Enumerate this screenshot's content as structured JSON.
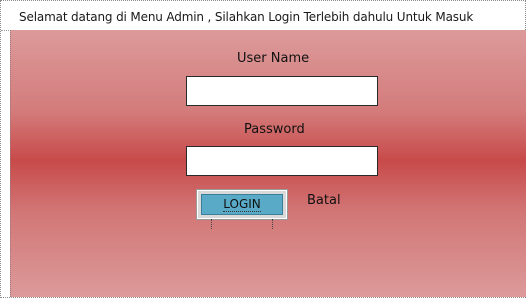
{
  "header": {
    "text": "Selamat datang di Menu Admin , Silahkan Login Terlebih dahulu Untuk Masuk"
  },
  "form": {
    "username_label": "User Name",
    "username_value": "",
    "password_label": "Password",
    "password_value": "",
    "login_label": "LOGIN",
    "cancel_label": "Batal"
  },
  "colors": {
    "panel_gradient_edge": "#dc9a9a",
    "panel_gradient_center": "#c84a4a",
    "login_button": "#58aac6"
  }
}
